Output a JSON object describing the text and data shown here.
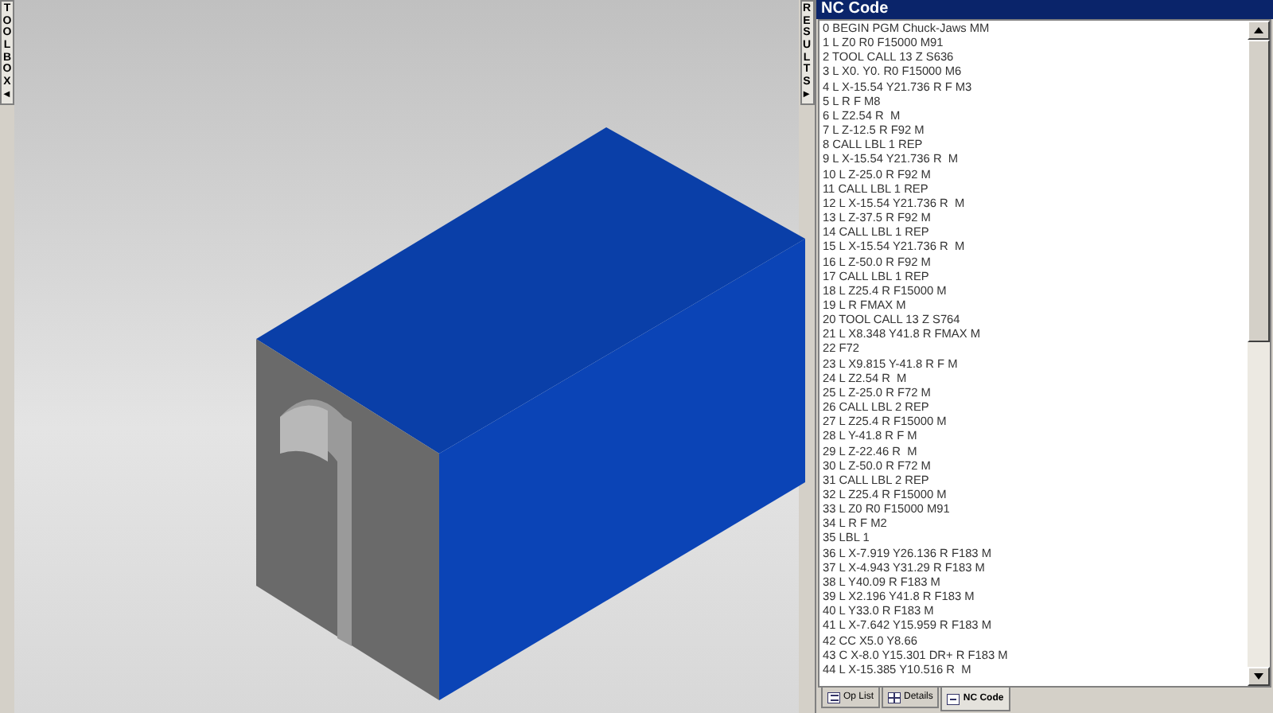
{
  "toolbox_tab": {
    "label": "TOOLBOX◂"
  },
  "results_tab": {
    "label": "RESULTS▸"
  },
  "panel": {
    "title": "NC Code"
  },
  "nc_lines": [
    "0 BEGIN PGM Chuck-Jaws MM",
    "1 L Z0 R0 F15000 M91",
    "2 TOOL CALL 13 Z S636",
    "3 L X0. Y0. R0 F15000 M6",
    "4 L X-15.54 Y21.736 R F M3",
    "5 L R F M8",
    "6 L Z2.54 R  M",
    "7 L Z-12.5 R F92 M",
    "8 CALL LBL 1 REP",
    "9 L X-15.54 Y21.736 R  M",
    "10 L Z-25.0 R F92 M",
    "11 CALL LBL 1 REP",
    "12 L X-15.54 Y21.736 R  M",
    "13 L Z-37.5 R F92 M",
    "14 CALL LBL 1 REP",
    "15 L X-15.54 Y21.736 R  M",
    "16 L Z-50.0 R F92 M",
    "17 CALL LBL 1 REP",
    "18 L Z25.4 R F15000 M",
    "19 L R FMAX M",
    "20 TOOL CALL 13 Z S764",
    "21 L X8.348 Y41.8 R FMAX M",
    "22 F72",
    "23 L X9.815 Y-41.8 R F M",
    "24 L Z2.54 R  M",
    "25 L Z-25.0 R F72 M",
    "26 CALL LBL 2 REP",
    "27 L Z25.4 R F15000 M",
    "28 L Y-41.8 R F M",
    "29 L Z-22.46 R  M",
    "30 L Z-50.0 R F72 M",
    "31 CALL LBL 2 REP",
    "32 L Z25.4 R F15000 M",
    "33 L Z0 R0 F15000 M91",
    "34 L R F M2",
    "35 LBL 1",
    "36 L X-7.919 Y26.136 R F183 M",
    "37 L X-4.943 Y31.29 R F183 M",
    "38 L Y40.09 R F183 M",
    "39 L X2.196 Y41.8 R F183 M",
    "40 L Y33.0 R F183 M",
    "41 L X-7.642 Y15.959 R F183 M",
    "42 CC X5.0 Y8.66",
    "43 C X-8.0 Y15.301 DR+ R F183 M",
    "44 L X-15.385 Y10.516 R  M"
  ],
  "tabs": [
    {
      "label": "Op List",
      "selected": false,
      "kind": "list"
    },
    {
      "label": "Details",
      "selected": false,
      "kind": "grid"
    },
    {
      "label": "NC Code",
      "selected": true,
      "kind": "code"
    }
  ]
}
